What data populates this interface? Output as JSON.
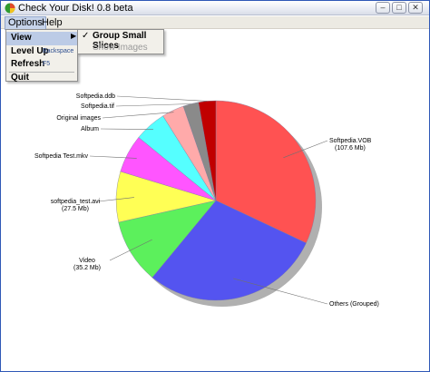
{
  "window": {
    "title": "Check Your Disk! 0.8 beta",
    "controls": {
      "minimize": "–",
      "maximize": "□",
      "close": "✕"
    }
  },
  "menubar": {
    "items": [
      "Options",
      "Help"
    ]
  },
  "dropdown": {
    "items": [
      {
        "label": "View",
        "shortcut": "",
        "has_submenu": true
      },
      {
        "label": "Level Up",
        "shortcut": "Backspace"
      },
      {
        "label": "Refresh",
        "shortcut": "F5"
      },
      {
        "label": "Quit",
        "shortcut": ""
      }
    ]
  },
  "submenu": {
    "items": [
      {
        "label": "Group Small Slices",
        "checked": true,
        "enabled": true
      },
      {
        "label": "Show Images",
        "checked": false,
        "enabled": false
      }
    ]
  },
  "chart_data": {
    "type": "pie",
    "start_angle_deg": 0,
    "slices": [
      {
        "label": "Softpedia.VOB",
        "size": "(107.6 Mb)",
        "percent": 32.0,
        "color": "#ff5252"
      },
      {
        "label": "Others (Grouped)",
        "size": "",
        "percent": 29.0,
        "color": "#5454f0"
      },
      {
        "label": "Video",
        "size": "(35.2 Mb)",
        "percent": 10.5,
        "color": "#5cf05c"
      },
      {
        "label": "softpedia_test.avi",
        "size": "(27.5 Mb)",
        "percent": 8.2,
        "color": "#ffff55"
      },
      {
        "label": "Softpedia Test.mkv",
        "size": "",
        "percent": 6.2,
        "color": "#ff55ff"
      },
      {
        "label": "Album",
        "size": "",
        "percent": 5.2,
        "color": "#55ffff"
      },
      {
        "label": "Original images",
        "size": "",
        "percent": 3.6,
        "color": "#ffaaaa"
      },
      {
        "label": "Softpedia.tif",
        "size": "",
        "percent": 2.5,
        "color": "#8a8a8a"
      },
      {
        "label": "Softpedia.ddb",
        "size": "",
        "percent": 2.8,
        "color": "#c00000"
      }
    ]
  }
}
